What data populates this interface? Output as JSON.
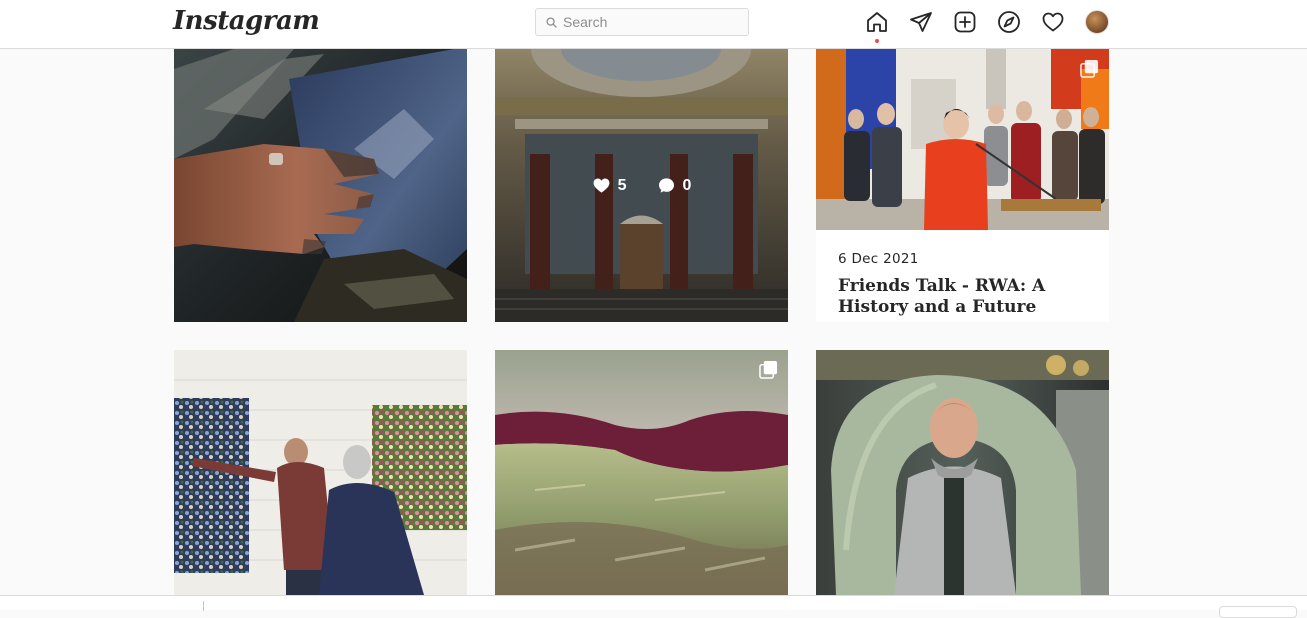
{
  "header": {
    "logo": "Instagram",
    "search": {
      "placeholder": "Search",
      "value": ""
    },
    "nav": [
      "home-icon",
      "direct-messages-icon",
      "new-post-icon",
      "explore-icon",
      "activity-heart-icon",
      "profile-avatar"
    ]
  },
  "posts": [
    {
      "id": "post-1",
      "subject": "paint-covered hand on blue canvas"
    },
    {
      "id": "post-2",
      "subject": "neoclassical gallery entrance",
      "likes": "5",
      "comments": "0"
    },
    {
      "id": "post-3",
      "multi": true,
      "date": "6 Dec 2021",
      "title": "Friends Talk - RWA: A History and a Future"
    },
    {
      "id": "post-4",
      "subject": "visitors viewing floral paintings"
    },
    {
      "id": "post-5",
      "multi": true,
      "subject": "landscape painting with purple hills"
    },
    {
      "id": "post-6",
      "subject": "man standing before large sculpture"
    }
  ],
  "colors": {
    "accent_dot": "#ed4956",
    "border": "#dbdbdb",
    "background": "#fafafa"
  }
}
